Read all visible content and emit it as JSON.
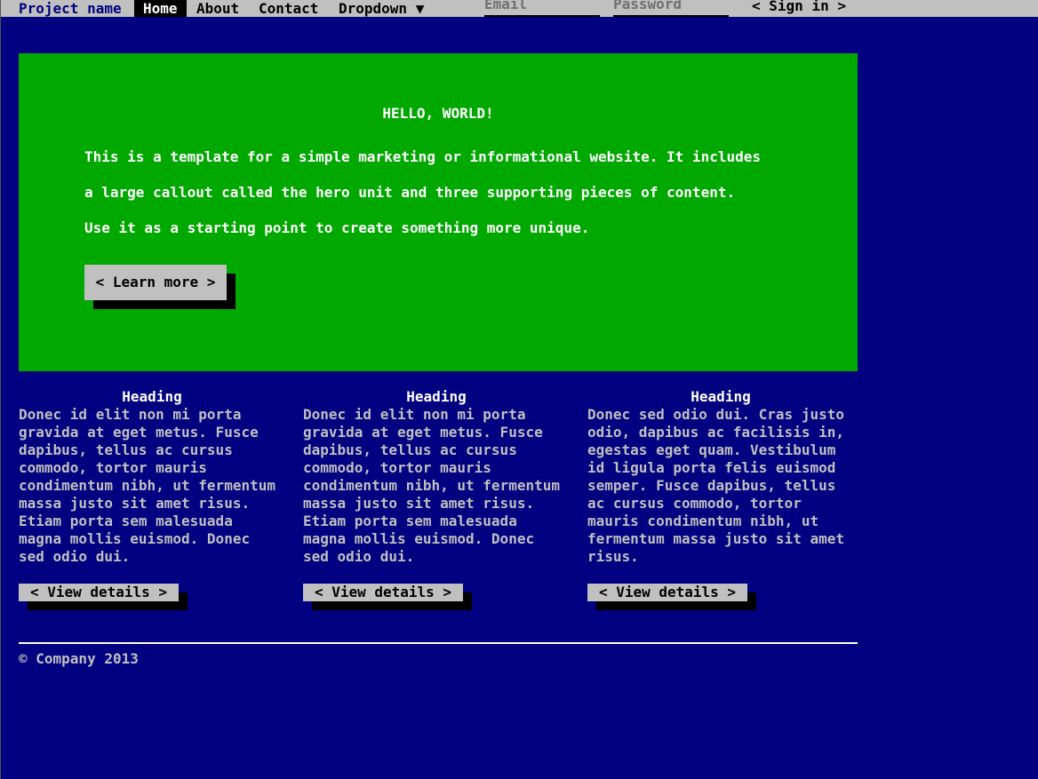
{
  "navbar": {
    "brand": "Project name",
    "items": [
      {
        "label": "Home",
        "active": true
      },
      {
        "label": "About",
        "active": false
      },
      {
        "label": "Contact",
        "active": false
      },
      {
        "label": "Dropdown ▼",
        "active": false
      }
    ],
    "email_placeholder": "Email",
    "password_placeholder": "Password",
    "signin_label": "< Sign in >"
  },
  "hero": {
    "title": "HELLO, WORLD!",
    "lines": [
      "This is a template for a simple marketing or informational website. It includes",
      "a large callout called the hero unit and three supporting pieces of content.",
      "Use it as a starting point to create something more unique."
    ],
    "button_label": "< Learn more >"
  },
  "columns": [
    {
      "heading": "Heading",
      "lines": [
        "Donec id elit non mi porta",
        "gravida at eget metus. Fusce",
        "dapibus, tellus ac cursus",
        "commodo, tortor mauris",
        "condimentum nibh, ut fermentum",
        "massa justo sit amet risus.",
        "Etiam porta sem malesuada",
        "magna mollis euismod. Donec",
        "sed odio dui."
      ],
      "button_label": "< View details >"
    },
    {
      "heading": "Heading",
      "lines": [
        "Donec id elit non mi porta",
        "gravida at eget metus. Fusce",
        "dapibus, tellus ac cursus",
        "commodo, tortor mauris",
        "condimentum nibh, ut fermentum",
        "massa justo sit amet risus.",
        "Etiam porta sem malesuada",
        "magna mollis euismod. Donec",
        "sed odio dui."
      ],
      "button_label": "< View details >"
    },
    {
      "heading": "Heading",
      "lines": [
        "Donec sed odio dui. Cras justo",
        "odio, dapibus ac facilisis in,",
        "egestas eget quam. Vestibulum",
        "id ligula porta felis euismod",
        "semper. Fusce dapibus, tellus",
        "ac cursus commodo, tortor",
        "mauris condimentum nibh, ut",
        "fermentum massa justo sit amet",
        "risus."
      ],
      "button_label": "< View details >"
    }
  ],
  "footer": {
    "text": "© Company 2013"
  },
  "colors": {
    "background": "#000080",
    "navbar": "#c0c0c0",
    "hero": "#00a800",
    "button": "#c0c0c0",
    "shadow": "#000000"
  }
}
